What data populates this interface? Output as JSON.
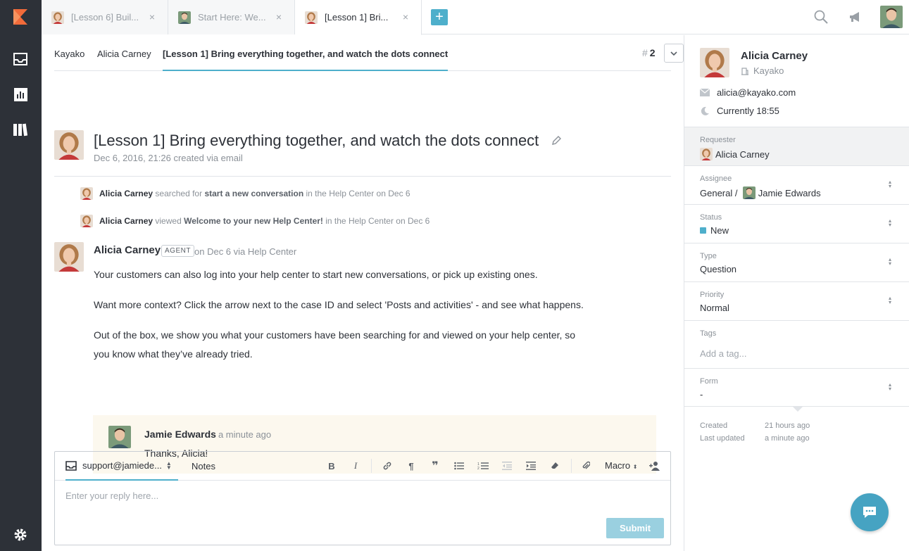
{
  "tabs": [
    {
      "label": "[Lesson 6] Buil...",
      "close": "×"
    },
    {
      "label": "Start Here: We...",
      "close": "×"
    },
    {
      "label": "[Lesson 1] Bri...",
      "close": "×"
    }
  ],
  "add_tab_label": "+",
  "breadcrumbs": {
    "org": "Kayako",
    "user": "Alicia Carney",
    "case": "[Lesson 1] Bring everything together, and watch the dots connect"
  },
  "case_id": {
    "hash": "#",
    "value": "2"
  },
  "case": {
    "title": "[Lesson 1] Bring everything together, and watch the dots connect",
    "subtitle": "Dec 6, 2016, 21:26 created via email"
  },
  "activities": [
    {
      "name": "Alicia Carney",
      "verb": "searched for",
      "object": "start a new conversation",
      "rest": "in the Help Center on Dec 6"
    },
    {
      "name": "Alicia Carney",
      "verb": "viewed",
      "object": "Welcome to your new Help Center!",
      "rest": "in the Help Center on Dec 6"
    }
  ],
  "post": {
    "author": "Alicia Carney",
    "badge": "AGENT",
    "meta": "on Dec 6 via Help Center",
    "paragraphs": [
      "Your customers can also log into your help center to start new conversations, or pick up existing ones.",
      "Want more context? Click the arrow next to the case ID and select 'Posts and activities' - and see what happens.",
      "Out of the box, we show you what your customers have been searching for and viewed on your help center, so you know what they’ve already tried."
    ]
  },
  "quoted_reply": {
    "author": "Jamie Edwards",
    "time": "a minute ago",
    "body": "Thanks, Alicia!"
  },
  "editor": {
    "from": "support@jamiede...",
    "notes_tab": "Notes",
    "macro_label": "Macro",
    "placeholder": "Enter your reply here...",
    "submit": "Submit"
  },
  "sidebar": {
    "name": "Alicia Carney",
    "org": "Kayako",
    "email": "alicia@kayako.com",
    "local_time": "Currently 18:55",
    "requester": {
      "label": "Requester",
      "value": "Alicia Carney"
    },
    "assignee": {
      "label": "Assignee",
      "team": "General /",
      "agent": "Jamie Edwards"
    },
    "status": {
      "label": "Status",
      "value": "New",
      "color": "#4eafcb"
    },
    "type": {
      "label": "Type",
      "value": "Question"
    },
    "priority": {
      "label": "Priority",
      "value": "Normal"
    },
    "tags": {
      "label": "Tags",
      "placeholder": "Add a tag..."
    },
    "form": {
      "label": "Form",
      "value": "-"
    },
    "created": {
      "label": "Created",
      "value": "21 hours ago"
    },
    "updated": {
      "label": "Last updated",
      "value": "a minute ago"
    }
  },
  "colors": {
    "accent": "#4eafcb",
    "nav_bg": "#2d3138",
    "brand_orange": "#f26b3a",
    "quote_bg": "#fcf8ee"
  }
}
